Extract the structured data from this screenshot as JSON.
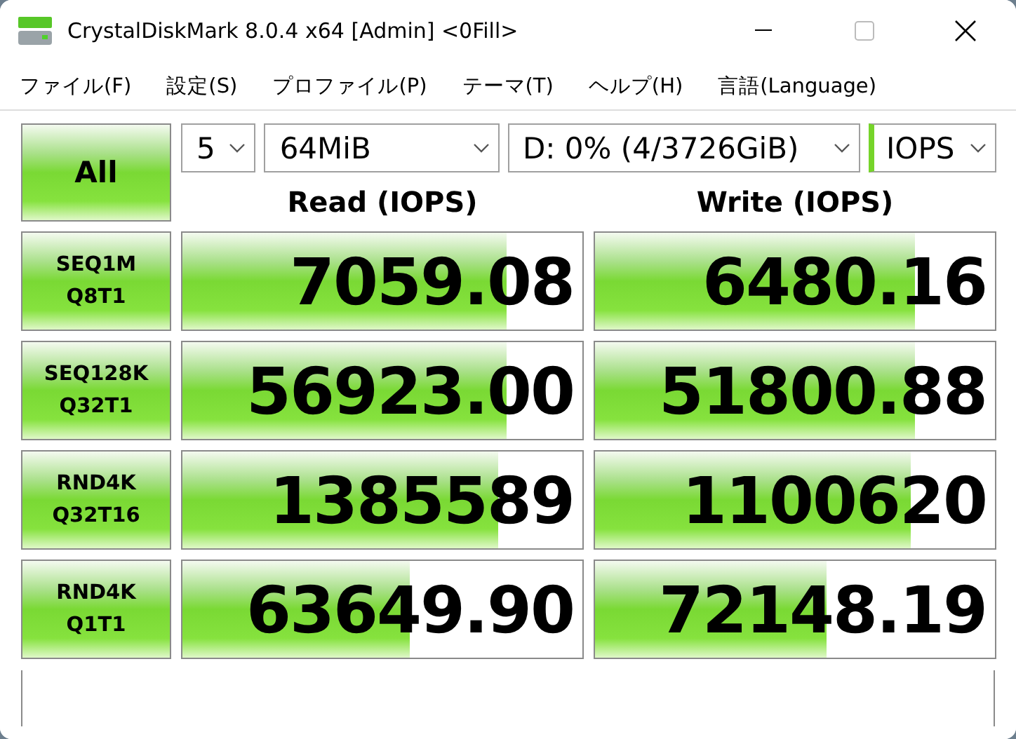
{
  "window": {
    "title": "CrystalDiskMark 8.0.4 x64 [Admin] <0Fill>"
  },
  "menu": [
    "ファイル(F)",
    "設定(S)",
    "プロファイル(P)",
    "テーマ(T)",
    "ヘルプ(H)",
    "言語(Language)"
  ],
  "all_button": "All",
  "selects": [
    {
      "value": "5",
      "kind": "plain"
    },
    {
      "value": "64MiB",
      "kind": "plain"
    },
    {
      "value": "D: 0% (4/3726GiB)",
      "kind": "plain"
    },
    {
      "value": "IOPS",
      "kind": "unit"
    }
  ],
  "columns": [
    "Read (IOPS)",
    "Write (IOPS)"
  ],
  "rows": [
    {
      "line1": "SEQ1M",
      "line2": "Q8T1",
      "read": {
        "value": "7059.08",
        "level": 0.81
      },
      "write": {
        "value": "6480.16",
        "level": 0.8
      }
    },
    {
      "line1": "SEQ128K",
      "line2": "Q32T1",
      "read": {
        "value": "56923.00",
        "level": 0.81
      },
      "write": {
        "value": "51800.88",
        "level": 0.8
      }
    },
    {
      "line1": "RND4K",
      "line2": "Q32T16",
      "read": {
        "value": "1385589",
        "level": 0.79
      },
      "write": {
        "value": "1100620",
        "level": 0.79
      }
    },
    {
      "line1": "RND4K",
      "line2": "Q1T1",
      "read": {
        "value": "63649.90",
        "level": 0.57
      },
      "write": {
        "value": "72148.19",
        "level": 0.58
      }
    }
  ]
}
